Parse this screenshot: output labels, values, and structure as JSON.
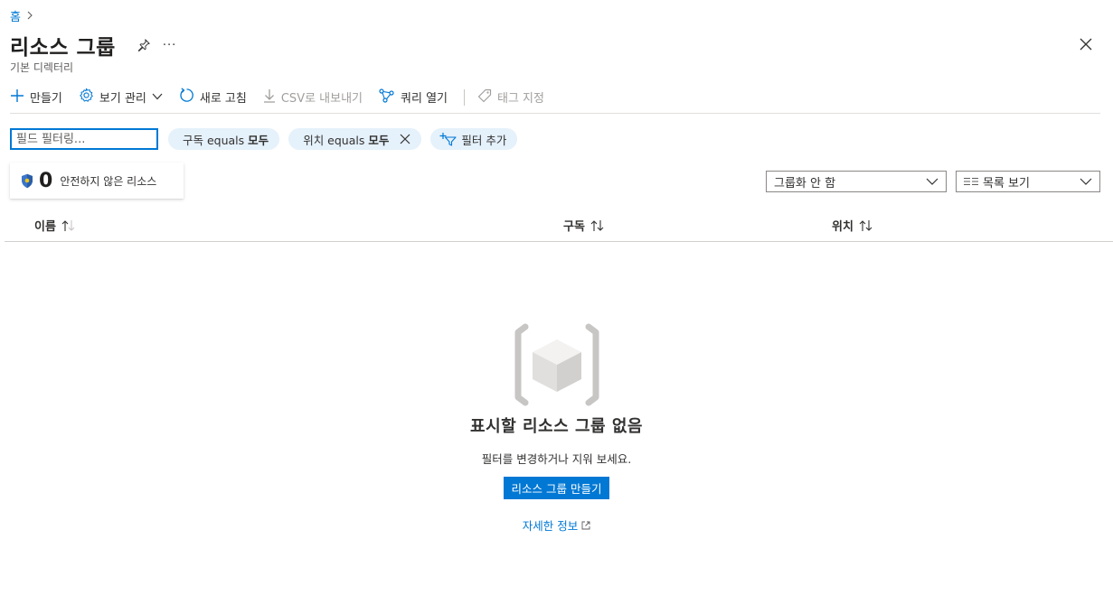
{
  "breadcrumb": {
    "home": "홈"
  },
  "header": {
    "title": "리소스 그룹",
    "subtitle": "기본 디렉터리",
    "more": "···"
  },
  "toolbar": {
    "create": "만들기",
    "manage_view": "보기 관리",
    "refresh": "새로 고침",
    "export_csv": "CSV로 내보내기",
    "open_query": "쿼리 열기",
    "assign_tags": "태그 지정"
  },
  "filters": {
    "search_placeholder": "필드 필터링...",
    "subscription_prefix": "구독 equals",
    "subscription_value": "모두",
    "location_prefix": "위치 equals",
    "location_value": "모두",
    "add_filter": "필터 추가"
  },
  "security": {
    "count": "0",
    "label": "안전하지 않은 리소스"
  },
  "grouping": {
    "selected": "그룹화 안 함"
  },
  "view_mode": {
    "selected": "목록 보기"
  },
  "table": {
    "columns": [
      "이름",
      "구독",
      "위치"
    ]
  },
  "empty_state": {
    "title": "표시할 리소스 그룹 없음",
    "description": "필터를 변경하거나 지워 보세요.",
    "create_button": "리소스 그룹 만들기",
    "learn_more": "자세한 정보"
  },
  "colors": {
    "accent": "#0078d4",
    "pill_bg": "#e5f1fb"
  }
}
